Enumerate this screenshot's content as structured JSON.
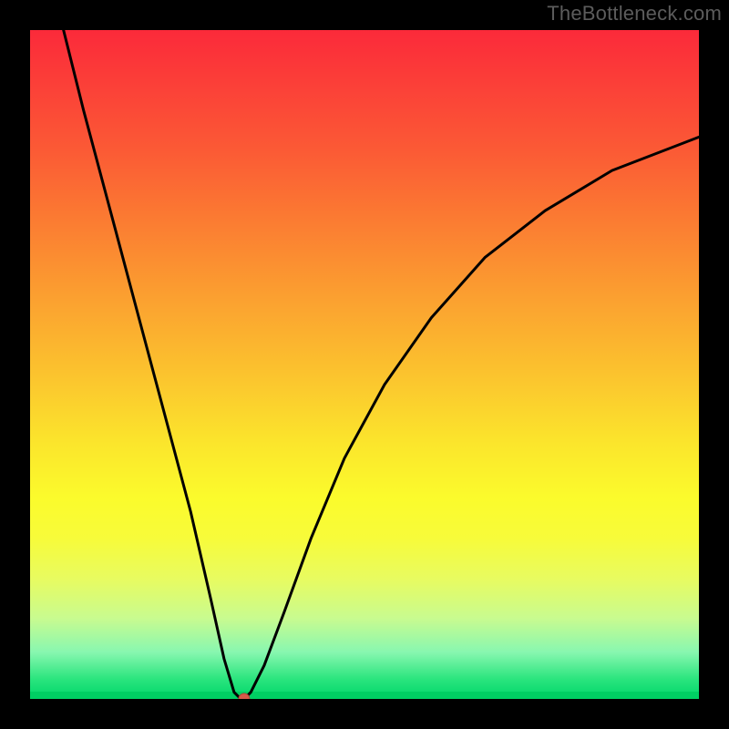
{
  "watermark": "TheBottleneck.com",
  "chart_data": {
    "type": "line",
    "title": "",
    "xlabel": "",
    "ylabel": "",
    "xlim": [
      0,
      100
    ],
    "ylim": [
      0,
      100
    ],
    "grid": false,
    "background_gradient": {
      "orientation": "vertical",
      "stops": [
        {
          "pos": 0.0,
          "color": "#fb2a3a"
        },
        {
          "pos": 0.4,
          "color": "#fba030"
        },
        {
          "pos": 0.7,
          "color": "#fbfb2c"
        },
        {
          "pos": 1.0,
          "color": "#00d66a"
        }
      ]
    },
    "series": [
      {
        "name": "bottleneck-curve",
        "color": "#000000",
        "x": [
          5,
          8,
          12,
          16,
          20,
          24,
          27,
          29,
          30.5,
          31.5,
          32,
          33,
          35,
          38,
          42,
          47,
          53,
          60,
          68,
          77,
          87,
          100
        ],
        "y": [
          100,
          88,
          73,
          58,
          43,
          28,
          15,
          6,
          1,
          0,
          0,
          1,
          5,
          13,
          24,
          36,
          47,
          57,
          66,
          73,
          79,
          84
        ]
      }
    ],
    "marker": {
      "name": "minimum-dot",
      "x": 32,
      "y": 0,
      "color": "#d65a4a",
      "radius_px": 6
    }
  }
}
